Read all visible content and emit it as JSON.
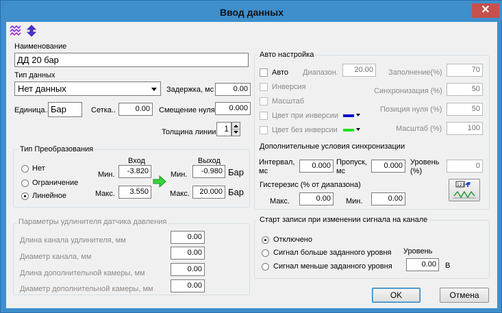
{
  "window": {
    "title": "Ввод данных",
    "close_glyph": "✕"
  },
  "toolbar": {
    "icons": [
      "wave-icon",
      "up-down-arrows-icon"
    ]
  },
  "left": {
    "name_label": "Наименование",
    "name_value": "ДД 20 бар",
    "type_label": "Тип данных",
    "type_value": "Нет данных",
    "delay_label": "Задержка, мс",
    "delay_value": "0.00",
    "unit_label": "Единица..",
    "unit_value": "Бар",
    "grid_label": "Сетка..",
    "grid_value": "0.00",
    "zero_shift_label": "Смещение нуля",
    "zero_shift_value": "0.000",
    "line_width_label": "Толщина линии...",
    "line_width_value": "1"
  },
  "transform": {
    "legend": "Тип Преобразования",
    "options": [
      "Нет",
      "Ограничение",
      "Линейное"
    ],
    "selected": 2,
    "in_header": "Вход",
    "out_header": "Выход",
    "min_label": "Мин.",
    "max_label": "Макс.",
    "in_min": "-3.820",
    "in_max": "3.550",
    "out_min": "-0.980",
    "out_max": "20.000",
    "out_unit_min": "Бар",
    "out_unit_max": "Бар"
  },
  "extender": {
    "legend": "Параметры удлинителя датчика давления",
    "rows": [
      {
        "label": "Длина канала удлинителя, мм",
        "value": "0.00"
      },
      {
        "label": "Диаметр канала, мм",
        "value": "0.00"
      },
      {
        "label": "Длина дополнительной камеры, мм",
        "value": "0.00"
      },
      {
        "label": "Диаметр дополнительной камеры, мм",
        "value": "0.00"
      }
    ]
  },
  "auto": {
    "legend": "Авто настройка",
    "auto_label": "Авто",
    "inversion_label": "Инверсия",
    "scale_label": "Масштаб",
    "inv_color_label": "Цвет при инверсии",
    "noinv_color_label": "Цвет без инверсии",
    "inv_color": "#0000cc",
    "noinv_color": "#22dd22",
    "range_label": "Диапазон.",
    "range_value": "20.00",
    "fill_label": "Заполнение(%)",
    "fill_value": "70",
    "sync_label": "Синхронизация (%)",
    "sync_value": "50",
    "zero_pos_label": "Позиция нуля (%)",
    "zero_pos_value": "50",
    "scale_pct_label": "Масштаб (%)",
    "scale_pct_value": "100",
    "extra_sync_title": "Дополнительные условия синхронизации",
    "interval_label": "Интервал,\nмс",
    "interval_value": "0.000",
    "skip_label": "Пропуск,\nмс",
    "skip_value": "0.000",
    "level_label": "Уровень\n(%)",
    "level_value": "0",
    "hyst_label": "Гистерезис (% от диапазона)",
    "hyst_max_label": "Макс.",
    "hyst_max_value": "0.00",
    "hyst_min_label": "Мин.",
    "hyst_min_value": "0.00"
  },
  "record": {
    "legend": "Старт записи при изменении сигнала на канале",
    "options": [
      "Отключено",
      "Сигнал больше заданного уровня",
      "Сигнал меньше заданного уровня"
    ],
    "selected": 0,
    "level_label": "Уровень",
    "level_value": "0.00",
    "level_unit": "В"
  },
  "buttons": {
    "ok": "OK",
    "cancel": "Отмена"
  }
}
